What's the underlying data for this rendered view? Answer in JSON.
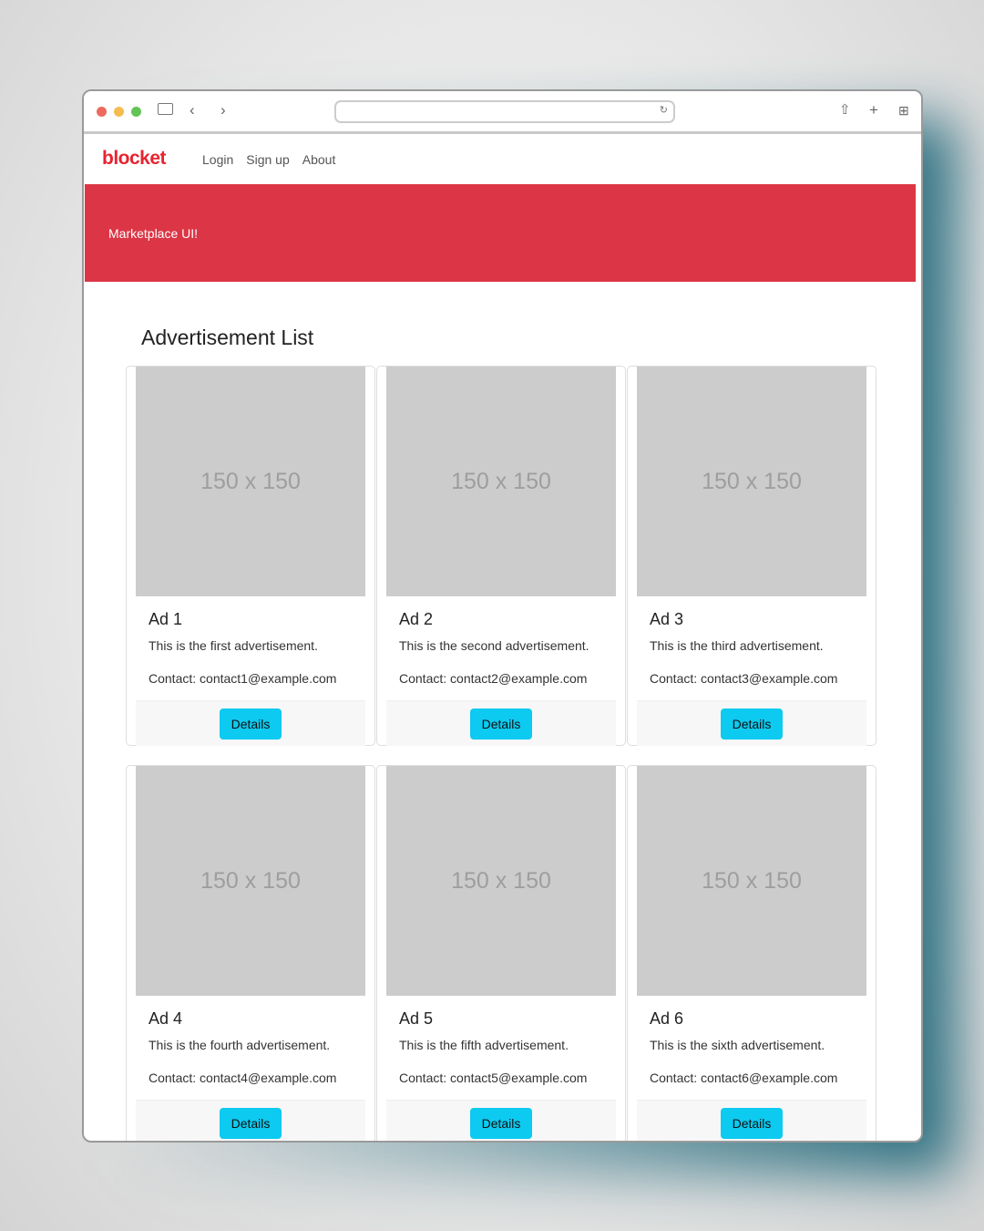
{
  "browser": {
    "reload_icon": "reload-icon"
  },
  "nav": {
    "brand": "blocket",
    "links": [
      "Login",
      "Sign up",
      "About"
    ]
  },
  "hero": {
    "text": "Marketplace UI!"
  },
  "heading": "Advertisement List",
  "ads": [
    {
      "image": "150 x 150",
      "title": "Ad 1",
      "description": "This is the first advertisement.",
      "contact": "Contact: contact1@example.com",
      "button": "Details"
    },
    {
      "image": "150 x 150",
      "title": "Ad 2",
      "description": "This is the second advertisement.",
      "contact": "Contact: contact2@example.com",
      "button": "Details"
    },
    {
      "image": "150 x 150",
      "title": "Ad 3",
      "description": "This is the third advertisement.",
      "contact": "Contact: contact3@example.com",
      "button": "Details"
    },
    {
      "image": "150 x 150",
      "title": "Ad 4",
      "description": "This is the fourth advertisement.",
      "contact": "Contact: contact4@example.com",
      "button": "Details"
    },
    {
      "image": "150 x 150",
      "title": "Ad 5",
      "description": "This is the fifth advertisement.",
      "contact": "Contact: contact5@example.com",
      "button": "Details"
    },
    {
      "image": "150 x 150",
      "title": "Ad 6",
      "description": "This is the sixth advertisement.",
      "contact": "Contact: contact6@example.com",
      "button": "Details"
    }
  ],
  "colors": {
    "brand": "#e8232f",
    "hero": "#dc3545",
    "button": "#0dcaf0"
  }
}
